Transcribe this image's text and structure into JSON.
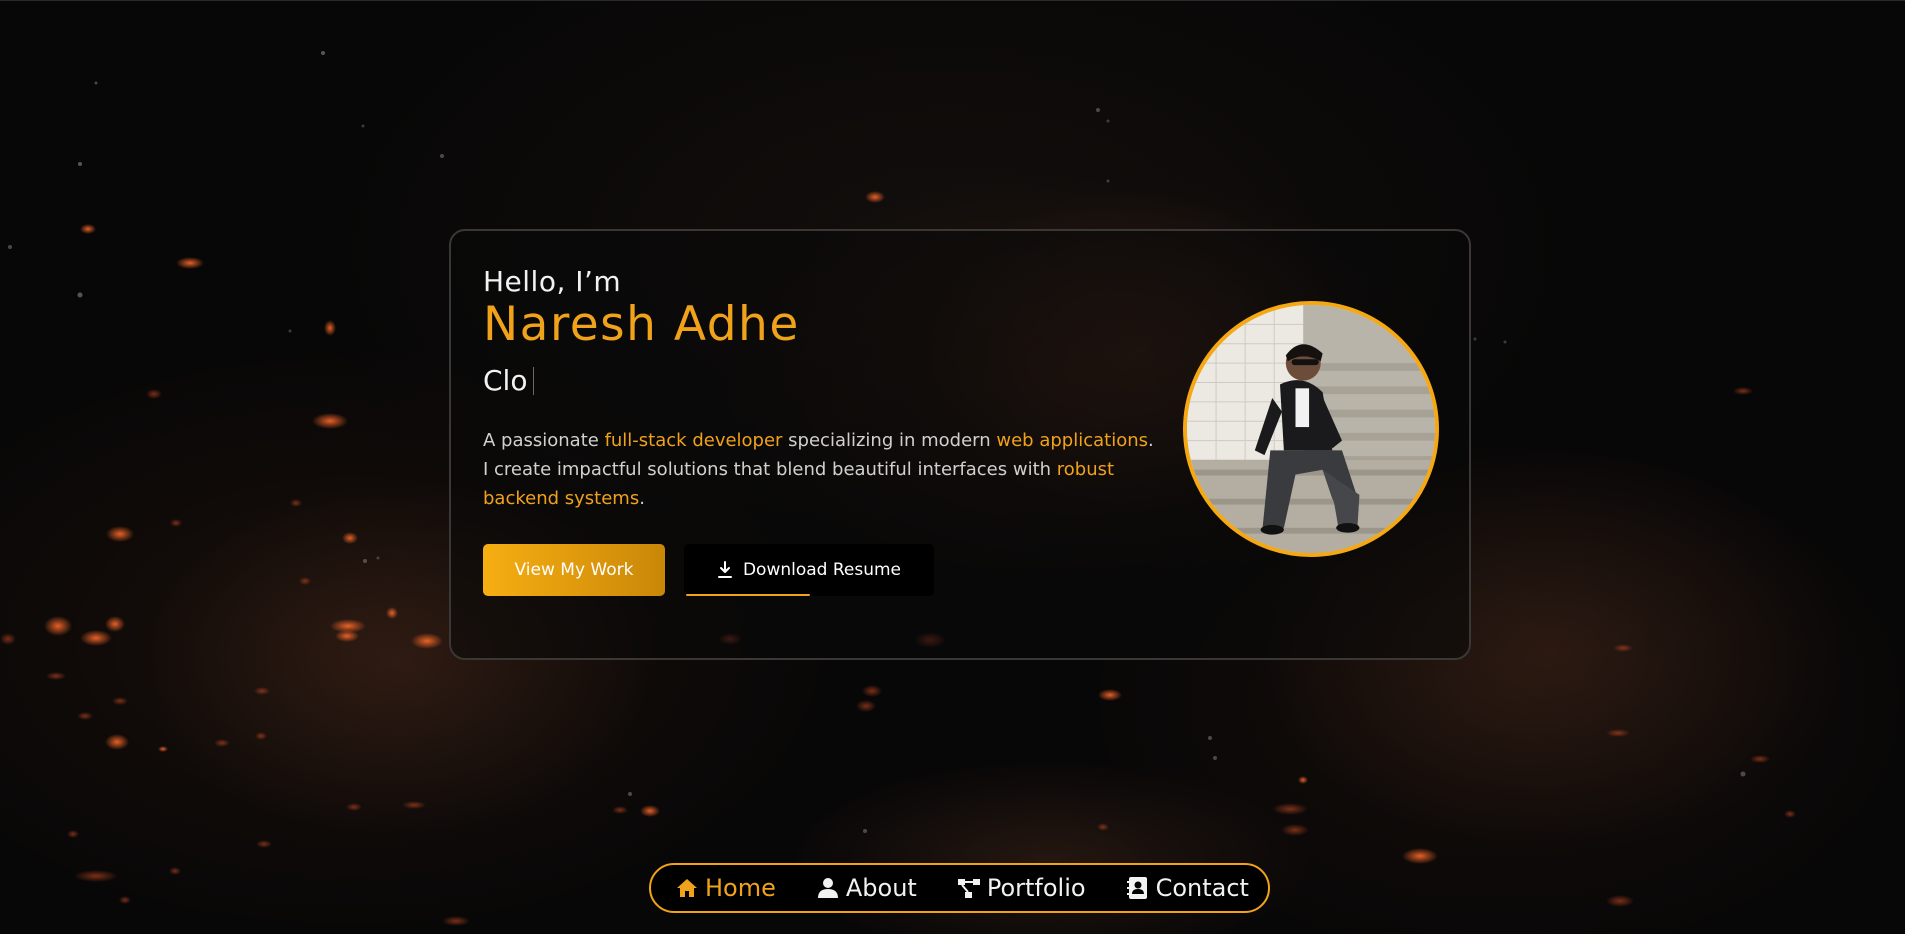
{
  "hero": {
    "greeting": "Hello, I’m",
    "name": "Naresh Adhe",
    "typed_text": "Clo",
    "description": {
      "part1": "A passionate ",
      "highlight1": "full-stack developer",
      "part2": " specializing in modern ",
      "highlight2": "web applications",
      "part3": ". I create impactful solutions that blend beautiful interfaces with ",
      "highlight3": "robust backend systems",
      "part4": "."
    },
    "primary_button": "View My Work",
    "secondary_button": "Download Resume",
    "download_icon": "download-icon",
    "avatar_icon": "profile-photo"
  },
  "nav": {
    "items": [
      {
        "label": "Home",
        "icon": "home-icon",
        "active": true
      },
      {
        "label": "About",
        "icon": "user-icon",
        "active": false
      },
      {
        "label": "Portfolio",
        "icon": "project-diagram-icon",
        "active": false
      },
      {
        "label": "Contact",
        "icon": "address-book-icon",
        "active": false
      }
    ]
  },
  "colors": {
    "accent": "#f0a21a",
    "background": "#080707",
    "card_border": "#3b3734",
    "text": "#f2f2f2"
  }
}
